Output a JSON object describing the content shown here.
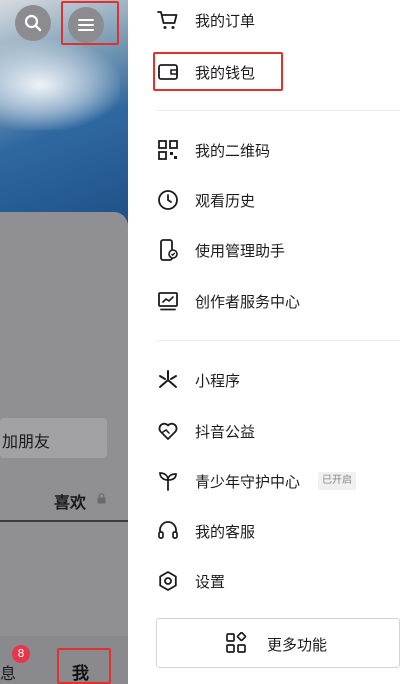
{
  "profile": {
    "add_friend_label": "加朋友",
    "likes_tab_label": "喜欢",
    "bottom_nav": {
      "messages_label": "息",
      "messages_badge": "8",
      "me_label": "我"
    }
  },
  "menu": {
    "items": [
      {
        "label": "我的订单",
        "icon": "cart-icon"
      },
      {
        "label": "我的钱包",
        "icon": "wallet-icon"
      },
      {
        "label": "我的二维码",
        "icon": "qrcode-icon"
      },
      {
        "label": "观看历史",
        "icon": "clock-icon"
      },
      {
        "label": "使用管理助手",
        "icon": "phone-settings-icon"
      },
      {
        "label": "创作者服务中心",
        "icon": "creator-chart-icon"
      },
      {
        "label": "小程序",
        "icon": "mini-program-icon"
      },
      {
        "label": "抖音公益",
        "icon": "heart-hands-icon"
      },
      {
        "label": "青少年守护中心",
        "icon": "sprout-icon",
        "tag": "已开启"
      },
      {
        "label": "我的客服",
        "icon": "headset-icon"
      },
      {
        "label": "设置",
        "icon": "settings-hexagon-icon"
      }
    ],
    "more_button_label": "更多功能"
  },
  "colors": {
    "highlight_box": "#e0312d",
    "badge": "#e5364a"
  }
}
